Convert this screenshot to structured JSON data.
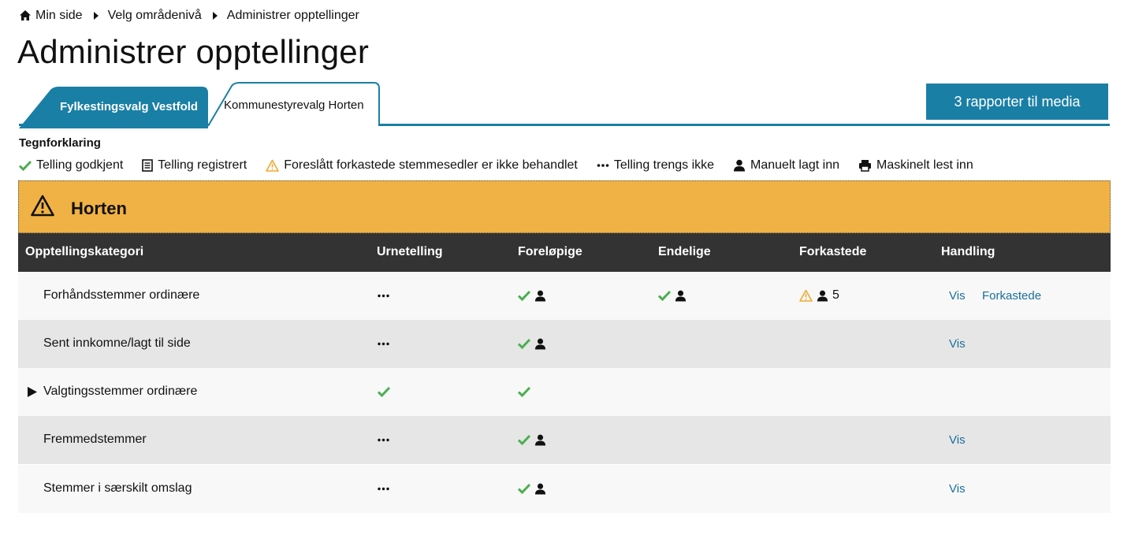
{
  "breadcrumb": {
    "items": [
      "Min side",
      "Velg områdenivå",
      "Administrer opptellinger"
    ]
  },
  "page_title": "Administrer opptellinger",
  "tabs": [
    {
      "label": "Fylkestingsvalg Vestfold",
      "active": false
    },
    {
      "label": "Kommunestyrevalg Horten",
      "active": true
    }
  ],
  "media_button": "3 rapporter til media",
  "legend": {
    "title": "Tegnforklaring",
    "items": [
      {
        "icon": "check-icon",
        "label": "Telling godkjent"
      },
      {
        "icon": "document-icon",
        "label": "Telling registrert"
      },
      {
        "icon": "warning-icon",
        "label": "Foreslått forkastede stemmesedler er ikke behandlet"
      },
      {
        "icon": "dots-icon",
        "label": "Telling trengs ikke"
      },
      {
        "icon": "person-icon",
        "label": "Manuelt lagt inn"
      },
      {
        "icon": "printer-icon",
        "label": "Maskinelt lest inn"
      }
    ]
  },
  "region": {
    "name": "Horten",
    "status_icon": "warning-icon",
    "status_color": "#f0b244"
  },
  "table": {
    "headers": [
      "Opptellingskategori",
      "Urnetelling",
      "Foreløpige",
      "Endelige",
      "Forkastede",
      "Handling"
    ],
    "rows": [
      {
        "category": "Forhåndsstemmer ordinære",
        "urnetelling": "dots",
        "forelopige": "check+person",
        "endelige": "check+person",
        "forkastede": "warning+person",
        "forkastede_count": "5",
        "actions": [
          "Vis",
          "Forkastede"
        ]
      },
      {
        "category": "Sent innkomne/lagt til side",
        "urnetelling": "dots",
        "forelopige": "check+person",
        "endelige": "",
        "forkastede": "",
        "forkastede_count": "",
        "actions": [
          "Vis"
        ]
      },
      {
        "category": "Valgtingsstemmer ordinære",
        "expandable": true,
        "urnetelling": "check",
        "forelopige": "check",
        "endelige": "",
        "forkastede": "",
        "forkastede_count": "",
        "actions": []
      },
      {
        "category": "Fremmedstemmer",
        "urnetelling": "dots",
        "forelopige": "check+person",
        "endelige": "",
        "forkastede": "",
        "forkastede_count": "",
        "actions": [
          "Vis"
        ]
      },
      {
        "category": "Stemmer i særskilt omslag",
        "urnetelling": "dots",
        "forelopige": "check+person",
        "endelige": "",
        "forkastede": "",
        "forkastede_count": "",
        "actions": [
          "Vis"
        ]
      }
    ]
  },
  "colors": {
    "accent": "#1a7fa5",
    "check": "#4caf50",
    "warning": "#f0a830",
    "header_bg": "#333333",
    "link": "#1a6f9a"
  }
}
